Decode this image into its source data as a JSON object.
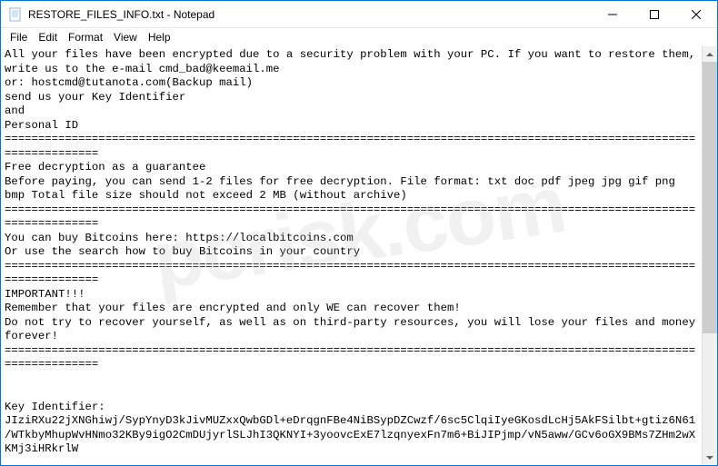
{
  "window": {
    "title": "RESTORE_FILES_INFO.txt - Notepad"
  },
  "menubar": {
    "items": [
      "File",
      "Edit",
      "Format",
      "View",
      "Help"
    ]
  },
  "content": {
    "text": "All your files have been encrypted due to a security problem with your PC. If you want to restore them, write us to the e-mail cmd_bad@keemail.me\nor: hostcmd@tutanota.com(Backup mail)\nsend us your Key Identifier\nand\nPersonal ID\n=====================================================================================================================\nFree decryption as a guarantee\nBefore paying, you can send 1-2 files for free decryption. File format: txt doc pdf jpeg jpg gif png bmp Total file size should not exceed 2 MB (without archive)\n=====================================================================================================================\nYou can buy Bitcoins here: https://localbitcoins.com\nOr use the search how to buy Bitcoins in your country\n=====================================================================================================================\nIMPORTANT!!!\nRemember that your files are encrypted and only WE can recover them!\nDo not try to recover yourself, as well as on third-party resources, you will lose your files and money forever!\n=====================================================================================================================\n\n\nKey Identifier:\nJIziRXu22jXNGhiwj/SypYnyD3kJivMUZxxQwbGDl+eDrqgnFBe4NiBSypDZCwzf/6sc5ClqiIyeGKosdLcHj5AkFSilbt+gtiz6N61/WTkbyMhupWvHNmo32KBy9igO2CmDUjyrlSLJhI3QKNYI+3yoovcExE7lzqnyexFn7m6+BiJIPjmp/vN5aww/GCv6oGX9BMs7ZHm2wXKMj3iHRkrlW"
  },
  "watermark": {
    "text": "pcrisk.com"
  }
}
